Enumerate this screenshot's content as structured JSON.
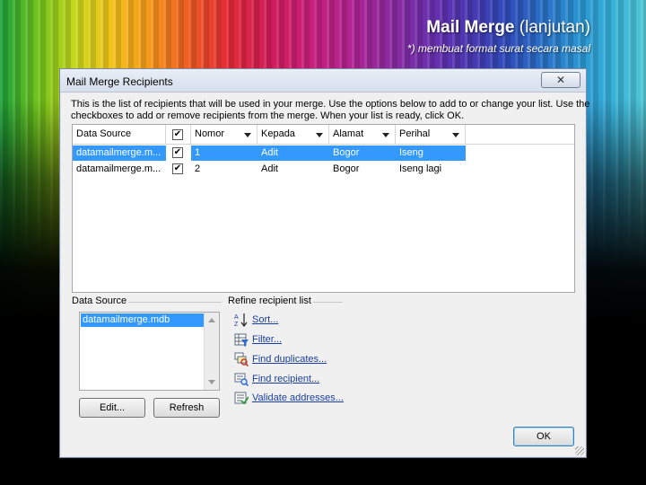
{
  "slide": {
    "title_bold": "Mail Merge",
    "title_rest": " (lanjutan)",
    "subtitle": "*) membuat format surat secara masal"
  },
  "dialog": {
    "title": "Mail Merge Recipients",
    "close_label": "✕",
    "intro_line1": "This is the list of recipients that will be used in your merge.  Use the options below to add to or change your list.  Use the",
    "intro_line2": "checkboxes to add or remove recipients from the merge.  When your list is ready, click OK.",
    "grid": {
      "columns": [
        "Data Source",
        "",
        "Nomor",
        "Kepada",
        "Alamat",
        "Perihal"
      ],
      "rows": [
        {
          "source": "datamailmerge.m...",
          "checked": "✔",
          "nomor": "1",
          "kepada": "Adit",
          "alamat": "Bogor",
          "perihal": "Iseng"
        },
        {
          "source": "datamailmerge.m...",
          "checked": "✔",
          "nomor": "2",
          "kepada": "Adit",
          "alamat": "Bogor",
          "perihal": "Iseng lagi"
        }
      ]
    },
    "data_source": {
      "label": "Data Source",
      "items": [
        "datamailmerge.mdb"
      ],
      "edit_label": "Edit...",
      "refresh_label": "Refresh"
    },
    "refine": {
      "label": "Refine recipient list",
      "items": [
        {
          "label": "Sort...",
          "icon": "sort-az-icon"
        },
        {
          "label": "Filter...",
          "icon": "filter-icon"
        },
        {
          "label": "Find duplicates...",
          "icon": "find-duplicates-icon"
        },
        {
          "label": "Find recipient...",
          "icon": "find-recipient-icon"
        },
        {
          "label": "Validate addresses...",
          "icon": "validate-addresses-icon"
        }
      ]
    },
    "ok_label": "OK"
  }
}
